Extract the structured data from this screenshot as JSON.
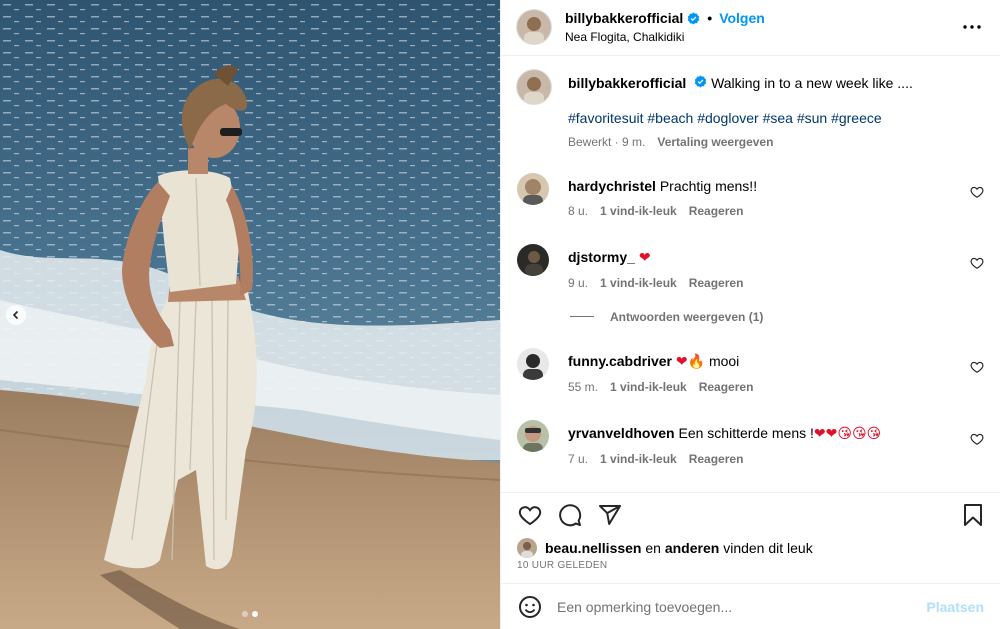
{
  "post": {
    "username": "billybakkerofficial",
    "follow_label": "Volgen",
    "separator": "•",
    "location": "Nea Flogita, Chalkidiki",
    "colors": {
      "accent": "#0095f6",
      "hashtag": "#00376b",
      "muted": "#737373",
      "heart": "#e0122b"
    }
  },
  "caption": {
    "username": "billybakkerofficial",
    "text": "Walking in to a new week like ....",
    "hashtags": "#favoritesuit #beach #doglover #sea #sun #greece",
    "edited": "Bewerkt",
    "time": "· 9 m.",
    "translate": "Vertaling weergeven"
  },
  "comments": [
    {
      "username": "hardychristel",
      "text": "Prachtig mens!!",
      "time": "8 u.",
      "likes": "1 vind-ik-leuk",
      "reply": "Reageren"
    },
    {
      "username": "djstormy_",
      "text": "❤",
      "time": "9 u.",
      "likes": "1 vind-ik-leuk",
      "reply": "Reageren",
      "view_replies": "Antwoorden weergeven (1)"
    },
    {
      "username": "funny.cabdriver",
      "text_pre": "❤🔥",
      "text": " mooi",
      "time": "55 m.",
      "likes": "1 vind-ik-leuk",
      "reply": "Reageren"
    },
    {
      "username": "yrvanveldhoven",
      "text": "Een schitterde mens !",
      "text_emoji": "❤❤😘😘😘",
      "time": "7 u.",
      "likes": "1 vind-ik-leuk",
      "reply": "Reageren"
    }
  ],
  "likes": {
    "user": "beau.nellissen",
    "and": " en ",
    "others": "anderen",
    "suffix": " vinden dit leuk"
  },
  "timestamp": "10 UUR GELEDEN",
  "add_comment": {
    "placeholder": "Een opmerking toevoegen...",
    "post_label": "Plaatsen"
  },
  "icons": {
    "verified": "verified-badge-icon",
    "more": "more-horizontal-icon",
    "like": "heart-icon",
    "comment": "comment-bubble-icon",
    "share": "paper-plane-icon",
    "save": "bookmark-icon",
    "emoji": "smiley-icon",
    "prev": "chevron-left-icon"
  },
  "carousel": {
    "count": 2,
    "active": 2
  }
}
